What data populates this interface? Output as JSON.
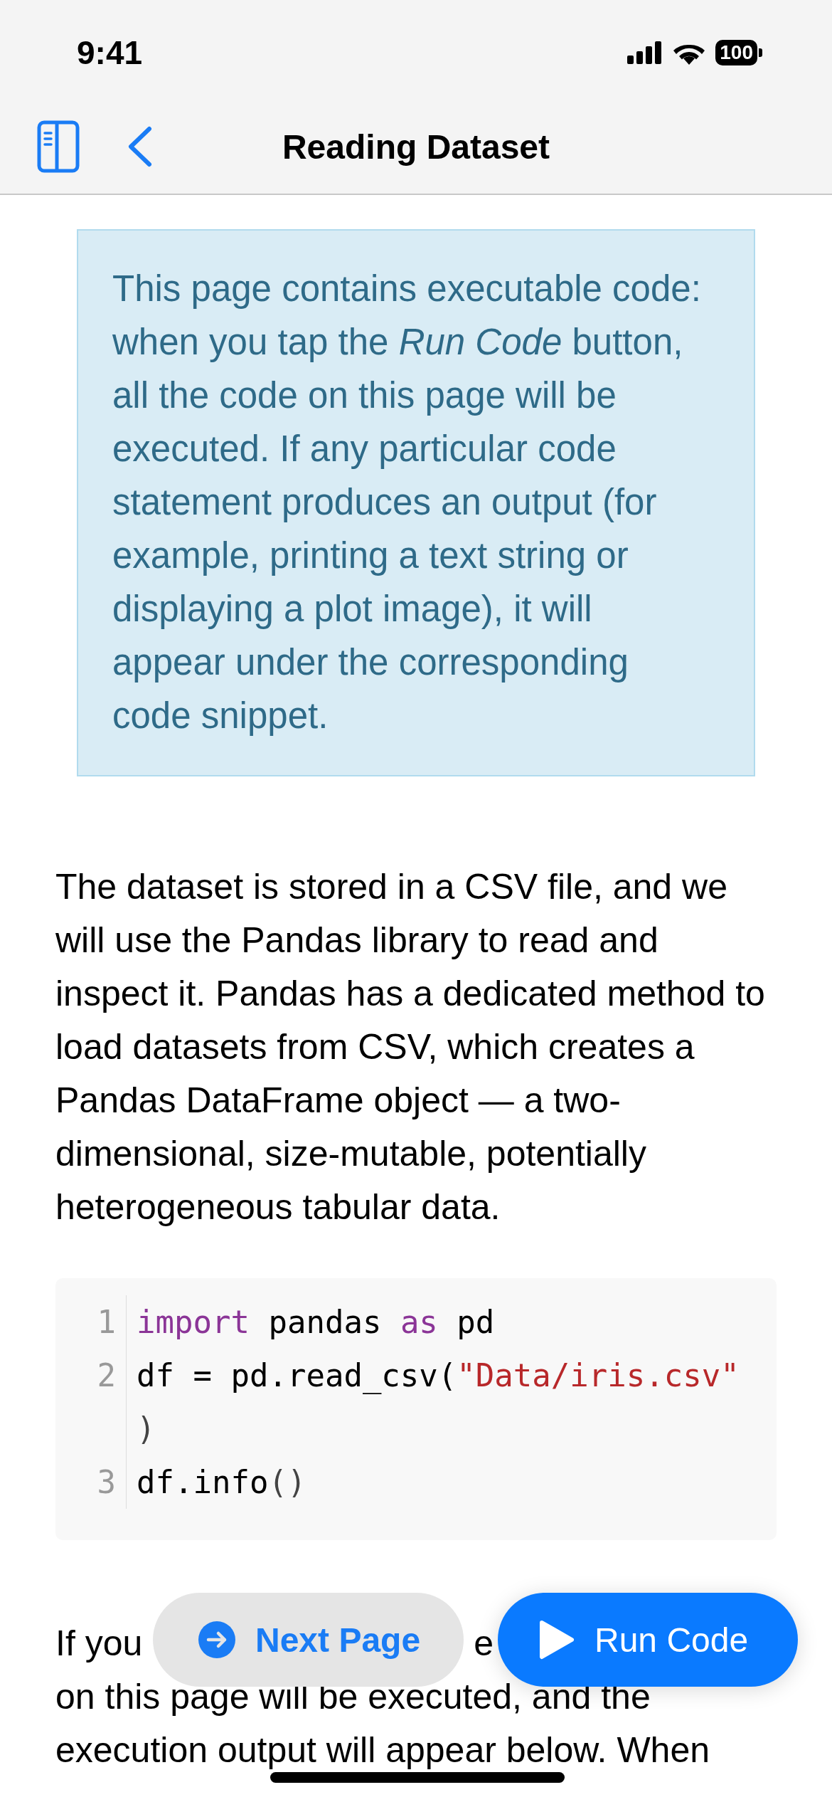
{
  "status_bar": {
    "time": "9:41",
    "battery": "100"
  },
  "nav_bar": {
    "title": "Reading Dataset"
  },
  "info_box": {
    "text": "This page contains executable code: when you tap the *Run Code* button, all the code on this page will be executed. If any particular code statement produces an output (for example, printing a text string or displaying a plot image), it will appear under the corresponding code snippet."
  },
  "paragraph": "The dataset is stored in a CSV file, and we will use the Pandas library to read and inspect it. Pandas has a dedicated method to load datasets from CSV, which creates a Pandas DataFrame object — a two-dimensional, size-mutable, potentially heterogeneous tabular data.",
  "code_block": {
    "lines": [
      {
        "number": "1",
        "tokens": [
          {
            "kind": "keyword",
            "text": "import"
          },
          {
            "kind": "plain",
            "text": " pandas "
          },
          {
            "kind": "keyword",
            "text": "as"
          },
          {
            "kind": "plain",
            "text": " pd"
          }
        ]
      },
      {
        "number": "2",
        "tokens": [
          {
            "kind": "plain",
            "text": "df = pd.read_csv("
          },
          {
            "kind": "string",
            "text": "\"Data/iris.csv\""
          }
        ]
      },
      {
        "tokens": [
          {
            "kind": "punct",
            "text": ")"
          }
        ]
      },
      {
        "number": "3",
        "tokens": [
          {
            "kind": "plain",
            "text": "df.info"
          },
          {
            "kind": "punct",
            "text": "()"
          }
        ]
      }
    ]
  },
  "paragraph_2": {
    "first_line_fragments": [
      "If you",
      "e"
    ],
    "lines": [
      "on this page will be executed, and the",
      "execution output will appear below. When"
    ]
  },
  "floating_buttons": [
    {
      "kind": "secondary",
      "label": "Next Page"
    },
    {
      "kind": "primary",
      "label": "Run Code"
    }
  ]
}
